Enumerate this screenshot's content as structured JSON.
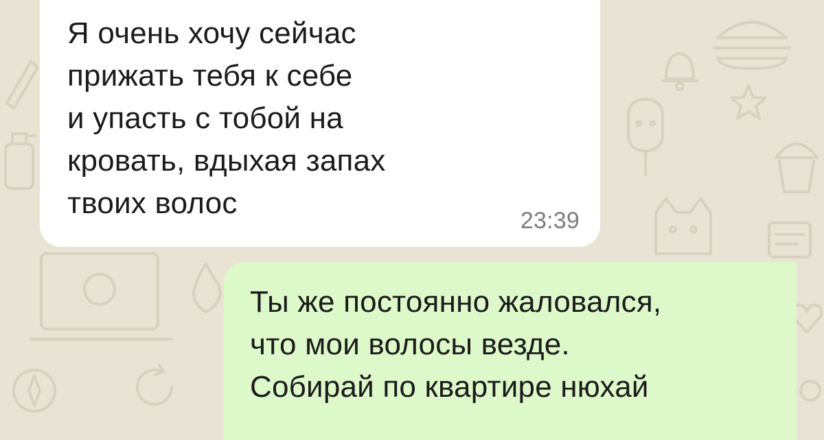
{
  "chat": {
    "messages": [
      {
        "direction": "incoming",
        "lines": [
          "Я очень хочу сейчас",
          "прижать тебя к себе",
          "и упасть с тобой на",
          "кровать, вдыхая запах",
          "твоих волос"
        ],
        "time": "23:39"
      },
      {
        "direction": "outgoing",
        "lines": [
          "Ты же постоянно жаловался,",
          "что мои волосы везде.",
          "Собирай по квартире нюхай"
        ]
      }
    ]
  },
  "colors": {
    "wallpaper": "#e9e3d6",
    "incoming_bubble": "#ffffff",
    "outgoing_bubble": "#ddf8c9",
    "timestamp": "#7d7d7d"
  }
}
